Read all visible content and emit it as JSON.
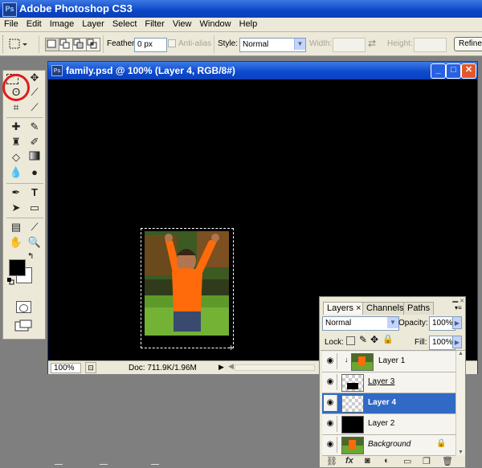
{
  "app": {
    "title": "Adobe Photoshop CS3",
    "logo": "Ps"
  },
  "menu": [
    "File",
    "Edit",
    "Image",
    "Layer",
    "Select",
    "Filter",
    "View",
    "Window",
    "Help"
  ],
  "options": {
    "feather_label": "Feather:",
    "feather_value": "0 px",
    "antialias_label": "Anti-alias",
    "style_label": "Style:",
    "style_value": "Normal",
    "width_label": "Width:",
    "height_label": "Height:",
    "refine_label": "Refine"
  },
  "document": {
    "title": "family.psd @ 100% (Layer 4, RGB/8#)",
    "zoom": "100%",
    "doc_info": "Doc: 711.9K/1.96M",
    "buttons": {
      "minimize": "_",
      "maximize": "□",
      "close": "✕"
    }
  },
  "colors": {
    "foreground": "#000000",
    "background": "#ffffff",
    "highlight_circle": "#e21b1b",
    "selected_layer": "#316ac5"
  },
  "layers_panel": {
    "tabs": [
      "Layers",
      "Channels",
      "Paths"
    ],
    "tab_close": "×",
    "blend_mode": "Normal",
    "opacity_label": "Opacity:",
    "opacity_value": "100%",
    "lock_label": "Lock:",
    "fill_label": "Fill:",
    "fill_value": "100%",
    "layers": [
      {
        "name": "Layer 1",
        "visible": true,
        "clipped": true
      },
      {
        "name": "Layer 3",
        "visible": true,
        "underlined": true
      },
      {
        "name": "Layer 4",
        "visible": true,
        "selected": true
      },
      {
        "name": "Layer 2",
        "visible": true
      },
      {
        "name": "Background",
        "visible": true,
        "locked": true
      }
    ],
    "footer_icons": [
      "link-icon",
      "fx-icon",
      "mask-icon",
      "adjustment-icon",
      "group-icon",
      "new-layer-icon",
      "trash-icon"
    ],
    "fx_label": "fx"
  }
}
